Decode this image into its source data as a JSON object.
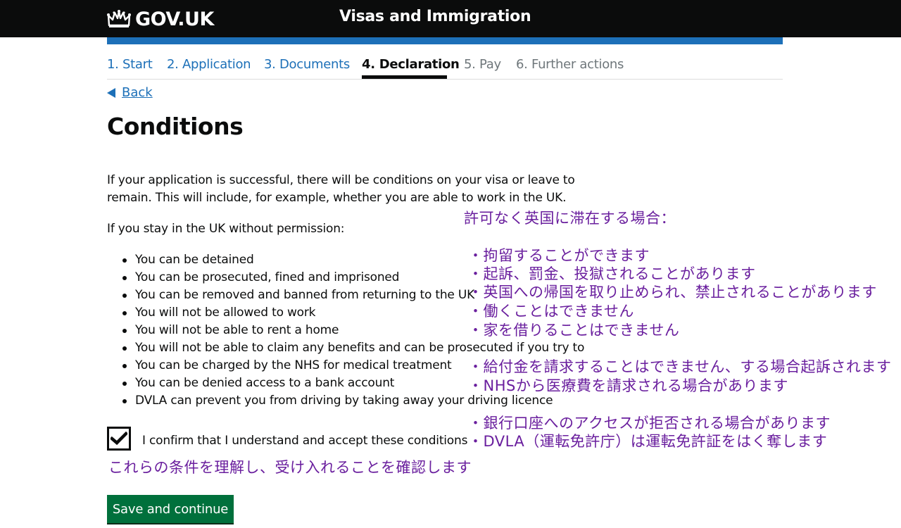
{
  "header": {
    "logo_text": "GOV.UK",
    "service_name": "Visas and Immigration"
  },
  "steps": [
    {
      "label": "1. Start",
      "state": "done"
    },
    {
      "label": "2. Application",
      "state": "done"
    },
    {
      "label": "3. Documents",
      "state": "done"
    },
    {
      "label": "4. Declaration",
      "state": "current"
    },
    {
      "label": "5. Pay",
      "state": "future"
    },
    {
      "label": "6. Further actions",
      "state": "future"
    }
  ],
  "back_label": "Back",
  "title": "Conditions",
  "intro_line1": "If your application is successful, there will be conditions on your visa or leave to",
  "intro_line2": "remain. This will include, for example, whether you are able to work in the UK.",
  "stay_text": "If you stay in the UK without permission:",
  "conditions": [
    "You can be detained",
    "You can be prosecuted, fined and imprisoned",
    "You can be removed and banned from returning to the UK",
    "You will not be allowed to work",
    "You will not be able to rent a home",
    "You will not be able to claim any benefits and can be prosecuted if you try to",
    "You can be charged by the NHS for medical treatment",
    "You can be denied access to a bank account",
    "DVLA can prevent you from driving by taking away your driving licence"
  ],
  "confirm": {
    "checked": true,
    "label": "I confirm that I understand and accept these conditions"
  },
  "japanese": {
    "heading": "許可なく英国に滞在する場合：",
    "items": [
      "・拘留することができます",
      "・起訴、罰金、投獄されることがあります",
      "・英国への帰国を取り止められ、禁止されることがあります",
      "・働くことはできません",
      "・家を借りることはできません",
      "・給付金を請求することはできません、する場合起訴されます",
      "・NHSから医療費を請求される場合があります",
      "・銀行口座へのアクセスが拒否される場合があります",
      "・DVLA（運転免許庁）は運転免許証をはく奪します"
    ],
    "confirm": "これらの条件を理解し、受け入れることを確認します"
  },
  "save_button": "Save and continue",
  "colors": {
    "header_bg": "#0b0c0c",
    "blue_bar": "#1d70b8",
    "link": "#1d70b8",
    "button_green": "#00703c",
    "annotation_purple": "#6a1f9e"
  }
}
